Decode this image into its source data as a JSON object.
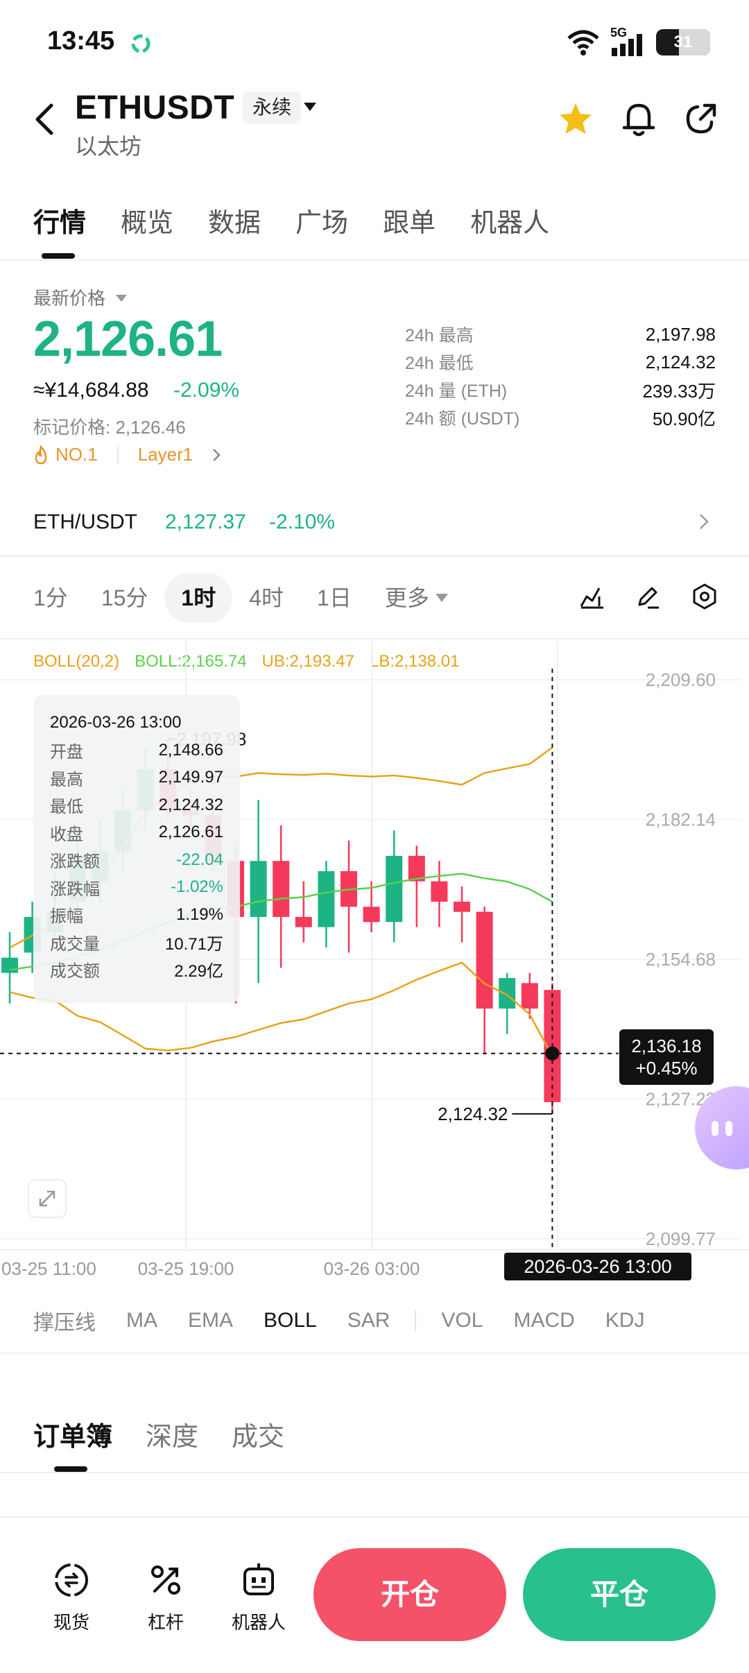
{
  "status": {
    "time": "13:45",
    "network": "5G",
    "battery": "31"
  },
  "header": {
    "pair": "ETHUSDT",
    "contract_type": "永续",
    "subtitle": "以太坊"
  },
  "tabs": [
    "行情",
    "概览",
    "数据",
    "广场",
    "跟单",
    "机器人"
  ],
  "price": {
    "label": "最新价格",
    "last": "2,126.61",
    "cny": "≈¥14,684.88",
    "change_pct": "-2.09%",
    "mark_price": "标记价格: 2,126.46",
    "tag_rank": "NO.1",
    "tag_sector": "Layer1"
  },
  "stats": [
    {
      "label": "24h  最高",
      "value": "2,197.98"
    },
    {
      "label": "24h  最低",
      "value": "2,124.32"
    },
    {
      "label": "24h  量 (ETH)",
      "value": "239.33万"
    },
    {
      "label": "24h  额 (USDT)",
      "value": "50.90亿"
    }
  ],
  "spot": {
    "pair": "ETH/USDT",
    "price": "2,127.37",
    "change": "-2.10%"
  },
  "intervals": [
    "1分",
    "15分",
    "1时",
    "4时",
    "1日",
    "更多"
  ],
  "active_interval": "1时",
  "boll_legend": {
    "name": "BOLL(20,2)",
    "mid": "BOLL:2,165.74",
    "ub": "UB:2,193.47",
    "lb": "LB:2,138.01"
  },
  "chart_data": {
    "type": "candlestick",
    "y_ticks": [
      "2,209.60",
      "2,182.14",
      "2,154.68",
      "2,127.23",
      "2,099.77"
    ],
    "ylim": [
      2099.77,
      2209.6
    ],
    "x_ticks": [
      "03-25 11:00",
      "03-25 19:00",
      "03-26 03:00"
    ],
    "high_label": "2,197.98",
    "low_label": "2,124.32",
    "crosshair_price": "2,136.18",
    "crosshair_change": "+0.45%",
    "crosshair_date": "2026-03-26 13:00",
    "candles": [
      {
        "o": 2152,
        "h": 2160,
        "l": 2146,
        "c": 2155
      },
      {
        "o": 2156,
        "h": 2166,
        "l": 2152,
        "c": 2163
      },
      {
        "o": 2160,
        "h": 2172,
        "l": 2158,
        "c": 2164
      },
      {
        "o": 2166,
        "h": 2178,
        "l": 2162,
        "c": 2175
      },
      {
        "o": 2170,
        "h": 2182,
        "l": 2166,
        "c": 2176
      },
      {
        "o": 2176,
        "h": 2188,
        "l": 2172,
        "c": 2184
      },
      {
        "o": 2184,
        "h": 2196,
        "l": 2180,
        "c": 2192
      },
      {
        "o": 2192,
        "h": 2197.98,
        "l": 2182,
        "c": 2184
      },
      {
        "o": 2184,
        "h": 2188,
        "l": 2180,
        "c": 2183
      },
      {
        "o": 2183,
        "h": 2187,
        "l": 2172,
        "c": 2174
      },
      {
        "o": 2174,
        "h": 2177,
        "l": 2146,
        "c": 2163
      },
      {
        "o": 2163,
        "h": 2186,
        "l": 2150,
        "c": 2174
      },
      {
        "o": 2174,
        "h": 2181,
        "l": 2153,
        "c": 2163
      },
      {
        "o": 2163,
        "h": 2170,
        "l": 2158,
        "c": 2161
      },
      {
        "o": 2161,
        "h": 2174,
        "l": 2157,
        "c": 2172
      },
      {
        "o": 2172,
        "h": 2178,
        "l": 2156,
        "c": 2165
      },
      {
        "o": 2165,
        "h": 2170,
        "l": 2160,
        "c": 2162
      },
      {
        "o": 2162,
        "h": 2180,
        "l": 2158,
        "c": 2175
      },
      {
        "o": 2175,
        "h": 2177,
        "l": 2161,
        "c": 2170
      },
      {
        "o": 2170,
        "h": 2174,
        "l": 2161,
        "c": 2166
      },
      {
        "o": 2166,
        "h": 2169,
        "l": 2158,
        "c": 2164
      },
      {
        "o": 2164,
        "h": 2165,
        "l": 2136,
        "c": 2145
      },
      {
        "o": 2145,
        "h": 2152,
        "l": 2140,
        "c": 2151
      },
      {
        "o": 2150,
        "h": 2152,
        "l": 2143,
        "c": 2145
      },
      {
        "o": 2148.66,
        "h": 2149.97,
        "l": 2124.32,
        "c": 2126.61
      }
    ],
    "indicators": [
      "撑压线",
      "MA",
      "EMA",
      "BOLL",
      "SAR",
      "VOL",
      "MACD",
      "KDJ"
    ],
    "active_indicator": "BOLL"
  },
  "tooltip": {
    "date": "2026-03-26 13:00",
    "rows": [
      {
        "label": "开盘",
        "value": "2,148.66"
      },
      {
        "label": "最高",
        "value": "2,149.97"
      },
      {
        "label": "最低",
        "value": "2,124.32"
      },
      {
        "label": "收盘",
        "value": "2,126.61"
      },
      {
        "label": "涨跌额",
        "value": "-22.04"
      },
      {
        "label": "涨跌幅",
        "value": "-1.02%"
      },
      {
        "label": "振幅",
        "value": "1.19%"
      },
      {
        "label": "成交量",
        "value": "10.71万"
      },
      {
        "label": "成交额",
        "value": "2.29亿"
      }
    ]
  },
  "orderbook_tabs": [
    "订单簿",
    "深度",
    "成交"
  ],
  "bottom_nav": [
    {
      "label": "现货"
    },
    {
      "label": "杠杆"
    },
    {
      "label": "机器人"
    }
  ],
  "actions": {
    "open": "开仓",
    "close": "平仓"
  },
  "colors": {
    "up": "#1db385",
    "down": "#f4395b",
    "boll_mid": "#5ad14a",
    "boll_band": "#e8a21a"
  }
}
